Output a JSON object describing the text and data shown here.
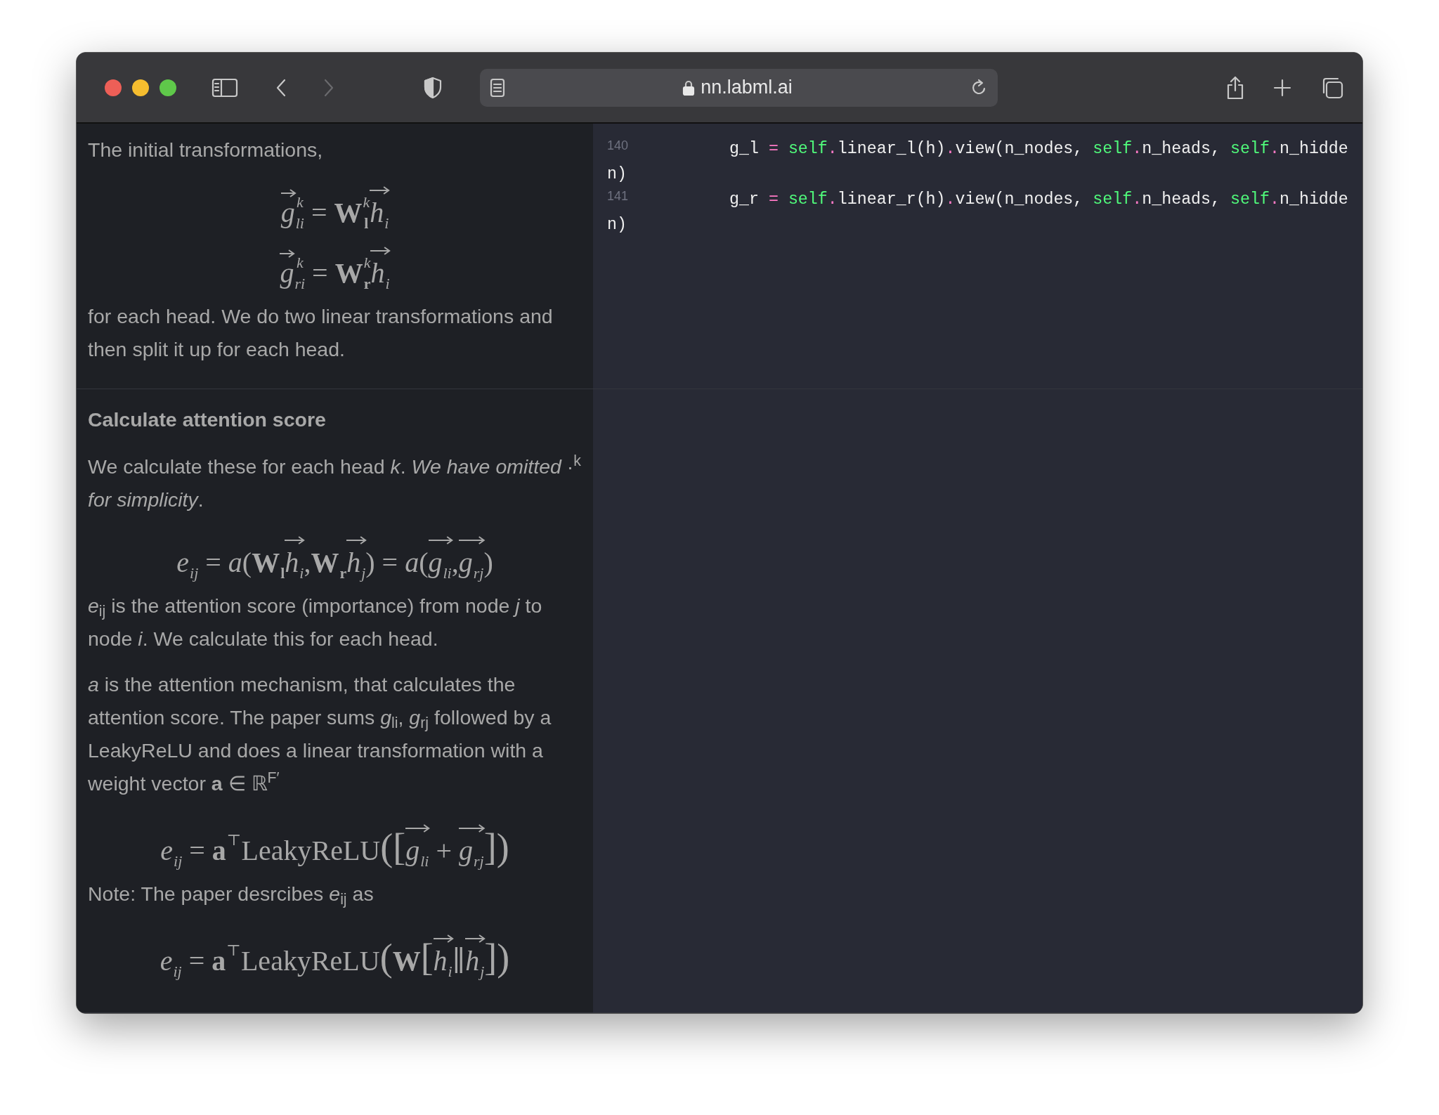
{
  "browser": {
    "back_disabled": false,
    "forward_disabled": true,
    "url": "nn.labml.ai"
  },
  "sections": [
    {
      "blocks": [
        {
          "kind": "text",
          "text": "The initial transformations,"
        },
        {
          "kind": "equation",
          "tokens": [
            {
              "kind": "sym",
              "t": "*g*",
              "sub": "*li*",
              "sup": "*k*",
              "vec": true
            },
            {
              "kind": "op",
              "t": "="
            },
            {
              "kind": "sym",
              "t": "**W**",
              "sub": "**l**",
              "sup": "*k*"
            },
            {
              "kind": "sym",
              "t": "*h*",
              "sub": "*i*",
              "vec": true
            }
          ]
        },
        {
          "kind": "equation",
          "tokens": [
            {
              "kind": "sym",
              "t": "*g*",
              "sub": "*ri*",
              "sup": "*k*",
              "vec": true
            },
            {
              "kind": "op",
              "t": "="
            },
            {
              "kind": "sym",
              "t": "**W**",
              "sub": "**r**",
              "sup": "*k*"
            },
            {
              "kind": "sym",
              "t": "*h*",
              "sub": "*i*",
              "vec": true
            }
          ]
        },
        {
          "kind": "text",
          "text": "for each head. We do two linear transformations and then split it up for each head."
        }
      ],
      "code": [
        {
          "number": "140",
          "continuation": "n)",
          "tokens": [
            {
              "kind": "plain",
              "t": "g_l "
            },
            {
              "kind": "op",
              "t": "="
            },
            {
              "kind": "self",
              "t": " self"
            },
            {
              "kind": "op",
              "t": "."
            },
            {
              "kind": "plain",
              "t": "linear_l(h)"
            },
            {
              "kind": "op",
              "t": "."
            },
            {
              "kind": "plain",
              "t": "view(n_nodes, "
            },
            {
              "kind": "self",
              "t": "self"
            },
            {
              "kind": "op",
              "t": "."
            },
            {
              "kind": "plain",
              "t": "n_heads, "
            },
            {
              "kind": "self",
              "t": "self"
            },
            {
              "kind": "op",
              "t": "."
            },
            {
              "kind": "plain",
              "t": "n_hidde"
            }
          ]
        },
        {
          "number": "141",
          "continuation": "n)",
          "tokens": [
            {
              "kind": "plain",
              "t": "g_r "
            },
            {
              "kind": "op",
              "t": "="
            },
            {
              "kind": "self",
              "t": " self"
            },
            {
              "kind": "op",
              "t": "."
            },
            {
              "kind": "plain",
              "t": "linear_r(h)"
            },
            {
              "kind": "op",
              "t": "."
            },
            {
              "kind": "plain",
              "t": "view(n_nodes, "
            },
            {
              "kind": "self",
              "t": "self"
            },
            {
              "kind": "op",
              "t": "."
            },
            {
              "kind": "plain",
              "t": "n_heads, "
            },
            {
              "kind": "self",
              "t": "self"
            },
            {
              "kind": "op",
              "t": "."
            },
            {
              "kind": "plain",
              "t": "n_hidde"
            }
          ]
        }
      ]
    },
    {
      "blocks": [
        {
          "kind": "heading",
          "text": "Calculate attention score"
        },
        {
          "kind": "text",
          "text": "We calculate these for each head *k*. *We have omitted* ·$^{k}$ *for simplicity*."
        },
        {
          "kind": "equation",
          "tokens": [
            {
              "kind": "sym",
              "t": "*e*",
              "sub": "*ij*"
            },
            {
              "kind": "op",
              "t": "="
            },
            {
              "kind": "sym",
              "t": "*a*("
            },
            {
              "kind": "sym",
              "t": "**W**",
              "sub": "**l**"
            },
            {
              "kind": "sym",
              "t": "*h*",
              "sub": "*i*",
              "vec": true
            },
            {
              "kind": "sym",
              "t": ", "
            },
            {
              "kind": "sym",
              "t": "**W**",
              "sub": "**r**"
            },
            {
              "kind": "sym",
              "t": "*h*",
              "sub": "*j*",
              "vec": true
            },
            {
              "kind": "sym",
              "t": ")"
            },
            {
              "kind": "op",
              "t": "="
            },
            {
              "kind": "sym",
              "t": "*a*("
            },
            {
              "kind": "sym",
              "t": "*g*",
              "sub": "*li*",
              "vec": true
            },
            {
              "kind": "sym",
              "t": ", "
            },
            {
              "kind": "sym",
              "t": "*g*",
              "sub": "*rj*",
              "vec": true
            },
            {
              "kind": "sym",
              "t": ")"
            }
          ]
        },
        {
          "kind": "text",
          "text": "*e*$_{ij}$ is the attention score (importance) from node *j* to node *i*. We calculate this for each head."
        },
        {
          "kind": "text",
          "text": "*a* is the attention mechanism, that calculates the attention score. The paper sums *g*$_{li}$, *g*$_{rj}$ followed by a LeakyReLU and does a linear transformation with a weight vector **a** ∈ ℝ$^{F′}$"
        },
        {
          "kind": "equation",
          "tokens": [
            {
              "kind": "sym",
              "t": "*e*",
              "sub": "*ij*"
            },
            {
              "kind": "op",
              "t": "="
            },
            {
              "kind": "sym",
              "t": "**a**",
              "sup": "⊤"
            },
            {
              "kind": "sym",
              "t": "LeakyReLU"
            },
            {
              "kind": "delim",
              "t": "("
            },
            {
              "kind": "delim",
              "t": "["
            },
            {
              "kind": "sym",
              "t": "*g*",
              "sub": "*li*",
              "vec": true
            },
            {
              "kind": "op",
              "t": "+"
            },
            {
              "kind": "sym",
              "t": "*g*",
              "sub": "*rj*",
              "vec": true
            },
            {
              "kind": "delim",
              "t": "]"
            },
            {
              "kind": "delim",
              "t": ")"
            }
          ]
        },
        {
          "kind": "text",
          "text": "Note: The paper desrcibes *e*$_{ij}$ as"
        },
        {
          "kind": "equation",
          "tokens": [
            {
              "kind": "sym",
              "t": "*e*",
              "sub": "*ij*"
            },
            {
              "kind": "op",
              "t": "="
            },
            {
              "kind": "sym",
              "t": "**a**",
              "sup": "⊤"
            },
            {
              "kind": "sym",
              "t": "LeakyReLU"
            },
            {
              "kind": "delim",
              "t": "("
            },
            {
              "kind": "sym",
              "t": "**W**"
            },
            {
              "kind": "delim",
              "t": "["
            },
            {
              "kind": "sym",
              "t": "*h*",
              "sub": "*i*",
              "vec": true
            },
            {
              "kind": "sym",
              "t": "∥"
            },
            {
              "kind": "sym",
              "t": "*h*",
              "sub": "*j*",
              "vec": true
            },
            {
              "kind": "delim",
              "t": "]"
            },
            {
              "kind": "delim",
              "t": ")"
            }
          ]
        }
      ]
    }
  ]
}
